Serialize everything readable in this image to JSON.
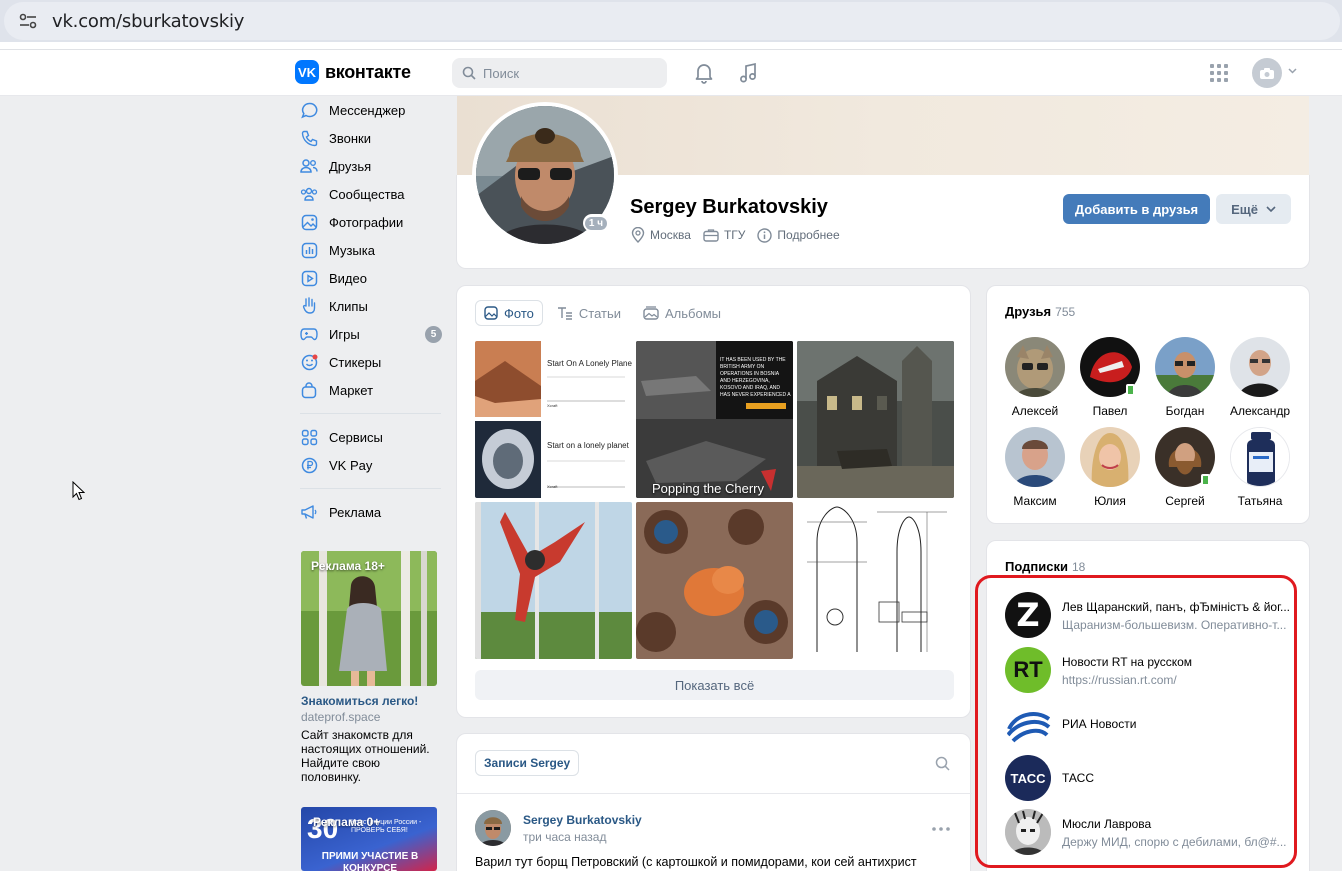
{
  "browser": {
    "url": "vk.com/sburkatovskiy"
  },
  "header": {
    "logo_text": "вконтакте",
    "search_placeholder": "Поиск"
  },
  "sidebar": {
    "items": [
      {
        "label": "Мессенджер",
        "icon": "messenger-icon"
      },
      {
        "label": "Звонки",
        "icon": "phone-icon"
      },
      {
        "label": "Друзья",
        "icon": "friends-icon"
      },
      {
        "label": "Сообщества",
        "icon": "communities-icon"
      },
      {
        "label": "Фотографии",
        "icon": "photos-icon"
      },
      {
        "label": "Музыка",
        "icon": "music-icon"
      },
      {
        "label": "Видео",
        "icon": "video-icon"
      },
      {
        "label": "Клипы",
        "icon": "clips-icon"
      },
      {
        "label": "Игры",
        "icon": "games-icon",
        "badge": "5"
      },
      {
        "label": "Стикеры",
        "icon": "stickers-icon"
      },
      {
        "label": "Маркет",
        "icon": "market-icon"
      },
      {
        "label": "Сервисы",
        "icon": "services-icon"
      },
      {
        "label": "VK Pay",
        "icon": "vkpay-icon"
      },
      {
        "label": "Реклама",
        "icon": "ads-icon"
      }
    ],
    "ad1": {
      "tag": "Реклама 18+",
      "title": "Знакомиться легко!",
      "domain": "dateprof.space",
      "desc": "Сайт знакомств для настоящих отношений. Найдите свою половинку."
    },
    "ad2": {
      "tag": "Реклама 0+",
      "number": "30",
      "text1": "Конституции России - ПРОВЕРЬ СЕБЯ!",
      "text2": "ПРИМИ УЧАСТИЕ В КОНКУРСЕ"
    }
  },
  "profile": {
    "name": "Sergey Burkatovskiy",
    "online": "1 ч",
    "city": "Москва",
    "university": "ТГУ",
    "more": "Подробнее",
    "add_friend": "Добавить в друзья",
    "more_button": "Ещё"
  },
  "photos": {
    "tabs": [
      "Фото",
      "Статьи",
      "Альбомы"
    ],
    "captions": {
      "p1a": "Start On A Lonely Planet",
      "p1b": "Start on a lonely planet",
      "p2": "Popping the Cherry"
    },
    "show_all": "Показать всё"
  },
  "wall": {
    "tab": "Записи Sergey",
    "post_author": "Sergey Burkatovskiy",
    "post_time": "три часа назад",
    "post_text": "Варил тут борщ Петровский (с картошкой и помидорами, кои сей антихрист"
  },
  "friends": {
    "title": "Друзья",
    "count": "755",
    "items": [
      "Алексей",
      "Павел",
      "Богдан",
      "Александр",
      "Максим",
      "Юлия",
      "Сергей",
      "Татьяна"
    ]
  },
  "subscriptions": {
    "title": "Подписки",
    "count": "18",
    "items": [
      {
        "title": "Лев Щаранский, панъ, фЂміністъ & йог...",
        "desc": "Щаранизм-большевизм. Оперативно-т..."
      },
      {
        "title": "Новости RT на русском",
        "desc": "https://russian.rt.com/"
      },
      {
        "title": "РИА Новости",
        "desc": ""
      },
      {
        "title": "ТАСС",
        "desc": ""
      },
      {
        "title": "Мюсли Лаврова",
        "desc": "Держу МИД, спорю с дебилами, бл@#..."
      }
    ],
    "logos": {
      "rt": "RT",
      "tass": "ТАСС",
      "z": "Z"
    }
  },
  "colors": {
    "accent": "#447bba",
    "link": "#2a5885",
    "highlight": "#e0191f"
  }
}
